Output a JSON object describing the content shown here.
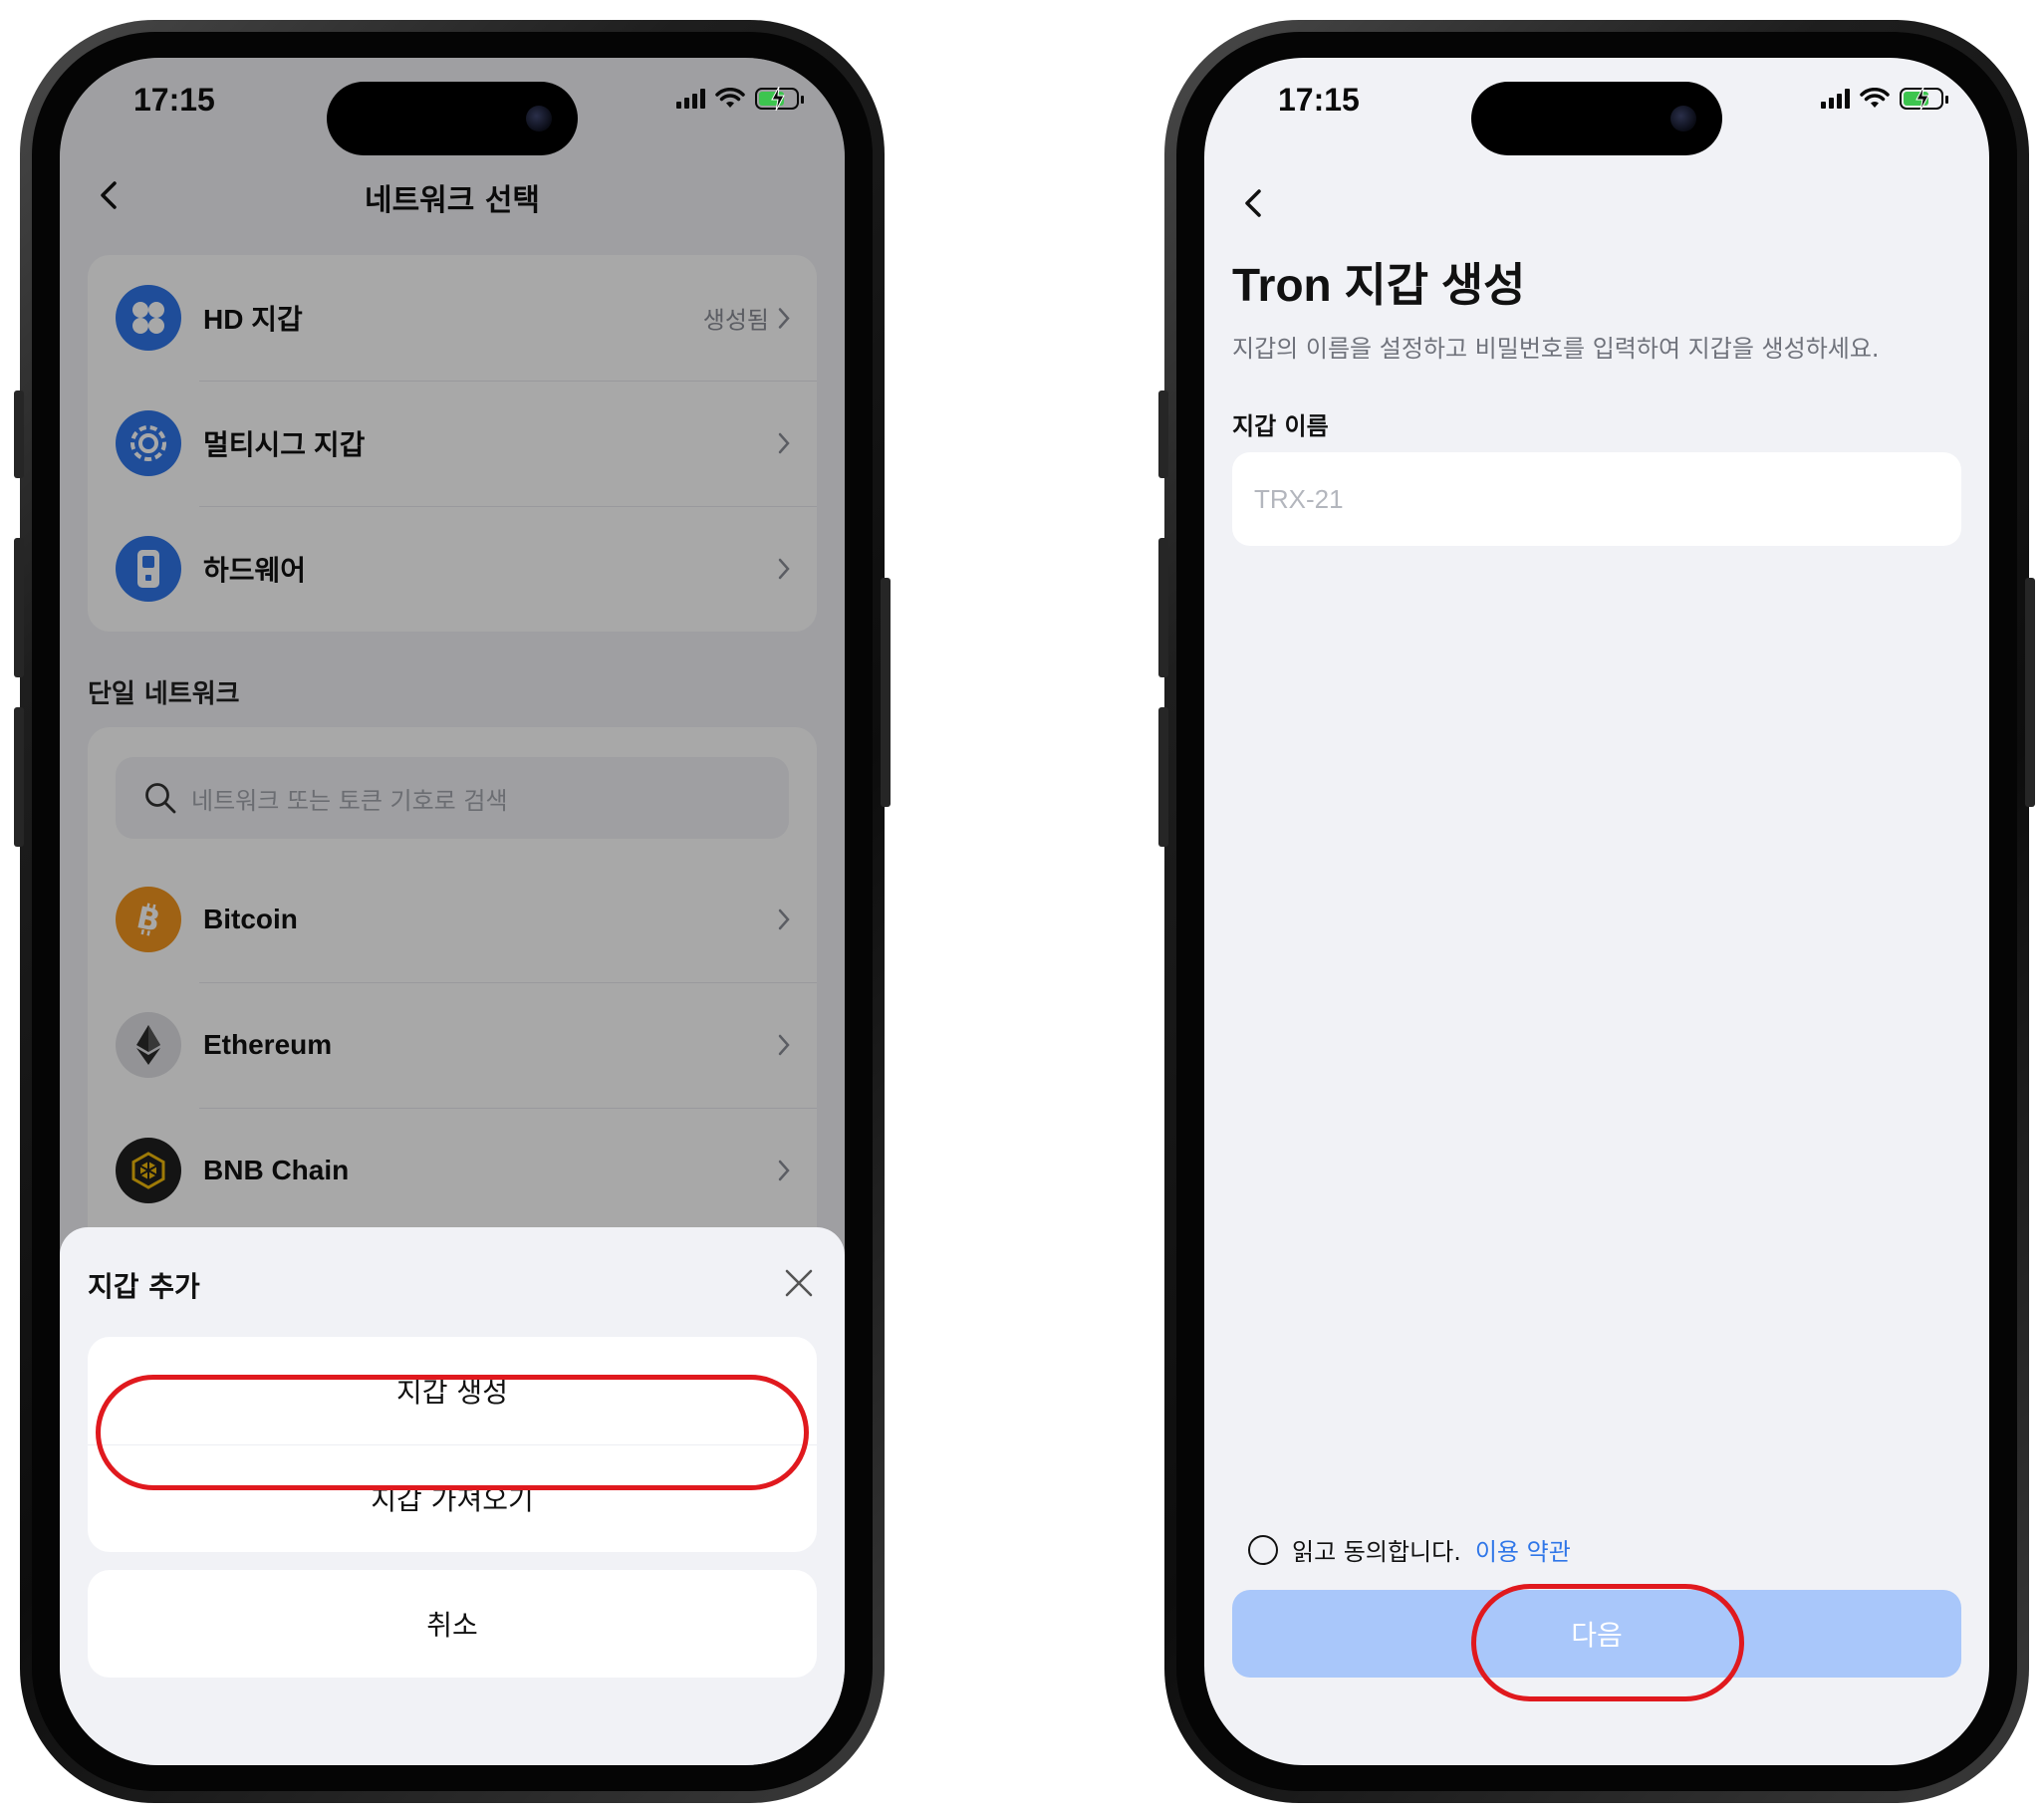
{
  "status": {
    "time": "17:15"
  },
  "left": {
    "nav_title": "네트워크 선택",
    "wallet_types": [
      {
        "label": "HD 지갑",
        "status": "생성됨",
        "icon": "hd-wallet-icon",
        "color": "#2f76e8"
      },
      {
        "label": "멀티시그 지갑",
        "status": "",
        "icon": "multisig-wallet-icon",
        "color": "#2f76e8"
      },
      {
        "label": "하드웨어",
        "status": "",
        "icon": "hardware-wallet-icon",
        "color": "#2f76e8"
      }
    ],
    "single_network_label": "단일 네트워크",
    "search_placeholder": "네트워크 또는 토큰 기호로 검색",
    "networks": [
      {
        "label": "Bitcoin",
        "icon": "bitcoin-icon",
        "color": "#f2951f"
      },
      {
        "label": "Ethereum",
        "icon": "ethereum-icon",
        "color": "#dfe0e4"
      },
      {
        "label": "BNB Chain",
        "icon": "bnb-chain-icon",
        "color": "#1f1f1f"
      }
    ],
    "sheet": {
      "title": "지갑 추가",
      "create_label": "지갑 생성",
      "import_label": "지갑 가져오기",
      "cancel_label": "취소"
    }
  },
  "right": {
    "title": "Tron 지갑 생성",
    "subtitle": "지갑의 이름을 설정하고 비밀번호를 입력하여 지갑을 생성하세요.",
    "name_label": "지갑 이름",
    "name_placeholder": "TRX-21",
    "agree_text": "읽고 동의합니다.",
    "terms_link": "이용 약관",
    "next_label": "다음"
  },
  "colors": {
    "accent": "#2f76e8",
    "highlight": "#e0191e",
    "disabled_button": "#a9c7fa"
  }
}
